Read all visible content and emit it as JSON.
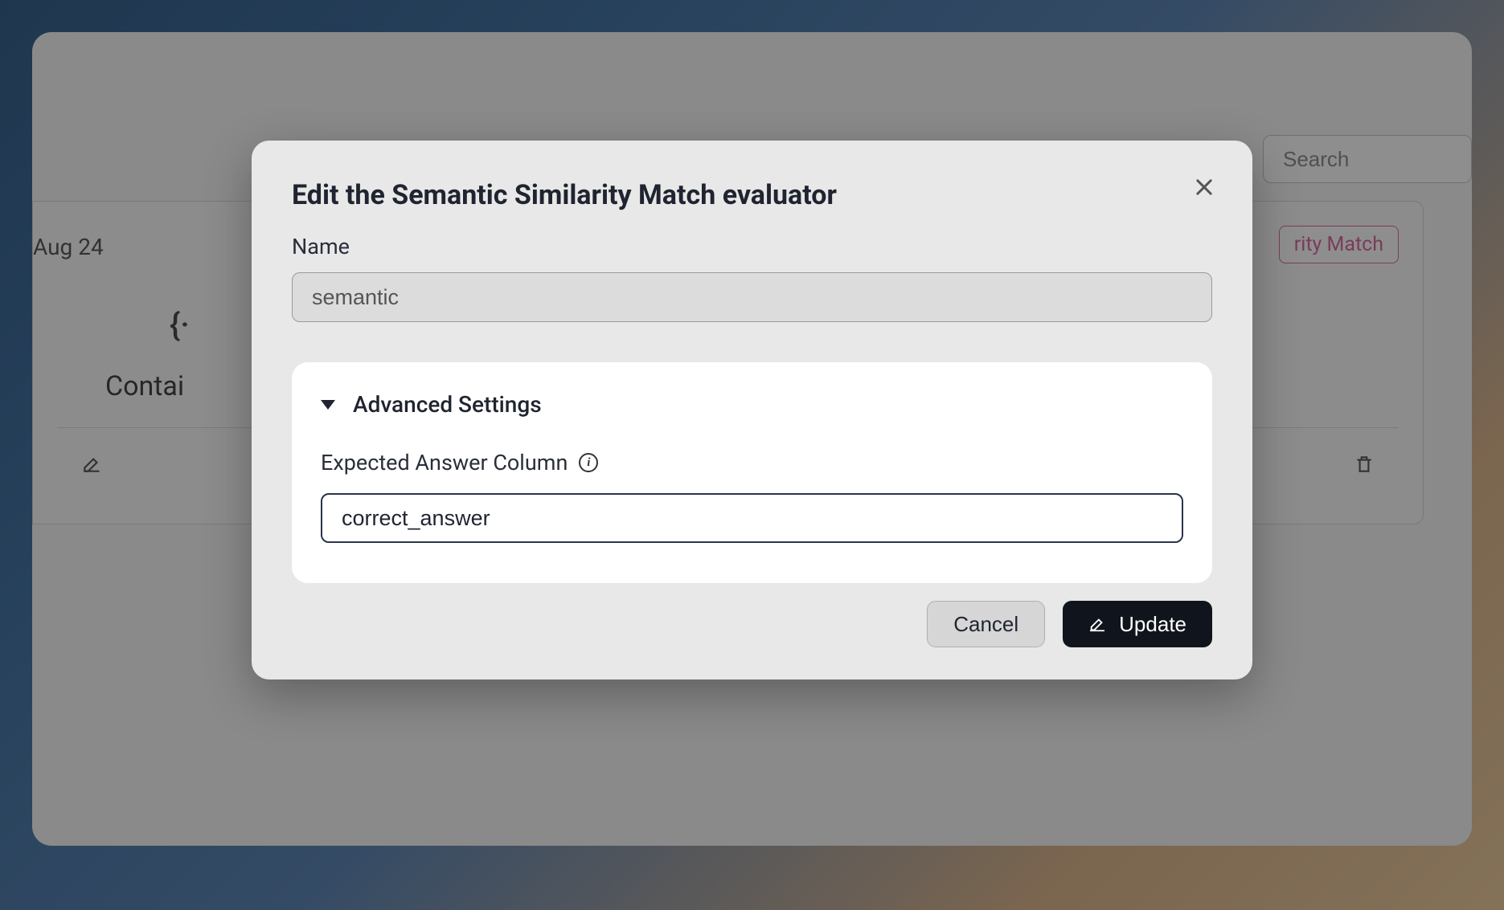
{
  "background": {
    "search_placeholder": "Search",
    "date_label": "Aug 24",
    "badge_text": "rity Match",
    "braces": "{·}",
    "contain_text": "Contai"
  },
  "modal": {
    "title": "Edit the Semantic Similarity Match evaluator",
    "name_label": "Name",
    "name_value": "semantic",
    "advanced_title": "Advanced Settings",
    "expected_label": "Expected Answer Column",
    "expected_value": "correct_answer",
    "cancel_label": "Cancel",
    "update_label": "Update"
  }
}
